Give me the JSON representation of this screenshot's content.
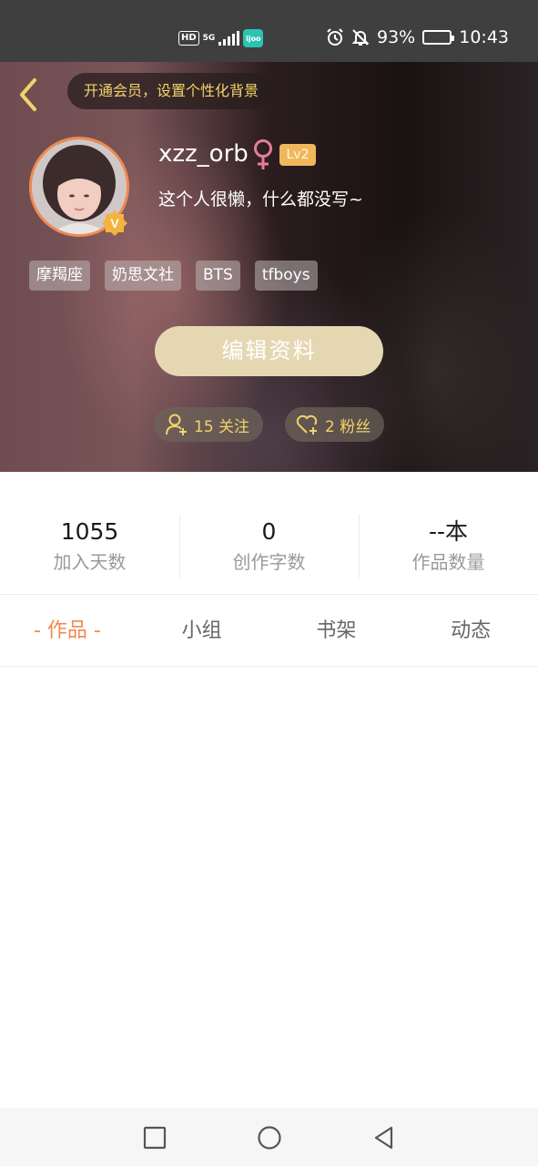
{
  "status_bar": {
    "hd": "HD",
    "network": "5G",
    "app_badge": "ijoo",
    "battery": "93%",
    "battery_level": 0.93,
    "time": "10:43"
  },
  "header": {
    "vip_banner": "开通会员，设置个性化背景"
  },
  "profile": {
    "username": "xzz_orb",
    "gender_symbol": "♀",
    "level": "Lv2",
    "bio": "这个人很懒，什么都没写~",
    "tags": [
      "摩羯座",
      "奶思文社",
      "BTS",
      "tfboys"
    ],
    "edit_button": "编辑资料",
    "following": "15 关注",
    "fans": "2 粉丝",
    "verified_badge": "V"
  },
  "stats": [
    {
      "value": "1055",
      "label": "加入天数"
    },
    {
      "value": "0",
      "label": "创作字数"
    },
    {
      "value": "--本",
      "label": "作品数量"
    }
  ],
  "tabs": [
    {
      "label": "- 作品 -",
      "active": true
    },
    {
      "label": "小组",
      "active": false
    },
    {
      "label": "书架",
      "active": false
    },
    {
      "label": "动态",
      "active": false
    }
  ],
  "colors": {
    "accent": "#f08a4f",
    "gold": "#f1d36a",
    "edit_button": "#e6d7b3",
    "level_badge": "#f0b75d"
  }
}
